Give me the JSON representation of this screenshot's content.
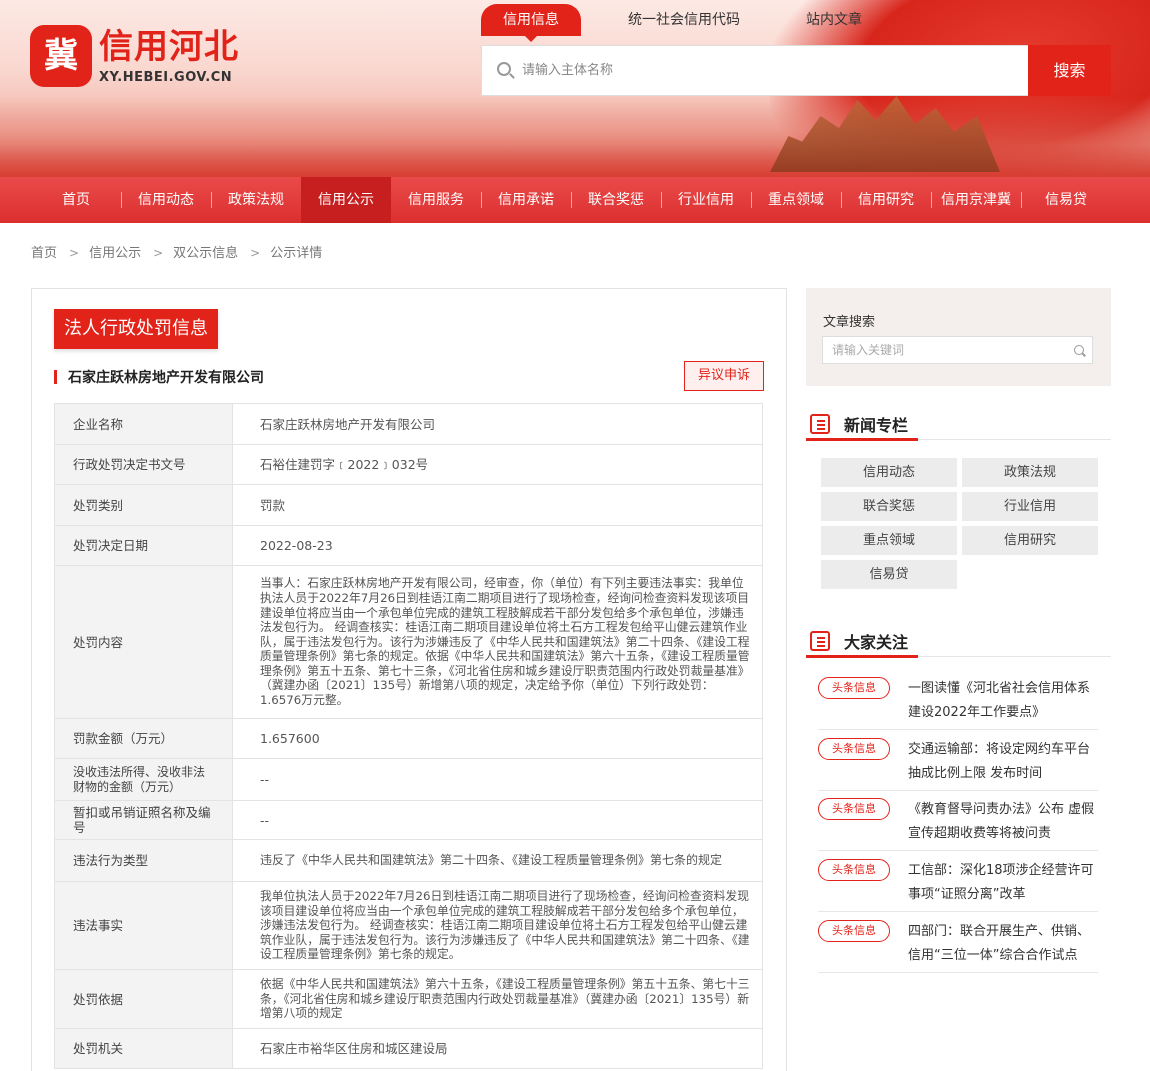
{
  "header": {
    "brand_name": "信用河北",
    "brand_url": "XY.HEBEI.GOV.CN",
    "search_tabs": [
      "信用信息",
      "统一社会信用代码",
      "站内文章"
    ],
    "search_placeholder": "请输入主体名称",
    "search_button": "搜索"
  },
  "nav": {
    "items": [
      "首页",
      "信用动态",
      "政策法规",
      "信用公示",
      "信用服务",
      "信用承诺",
      "联合奖惩",
      "行业信用",
      "重点领域",
      "信用研究",
      "信用京津冀",
      "信易贷"
    ],
    "active": "信用公示"
  },
  "breadcrumb": [
    "首页",
    "信用公示",
    "双公示信息",
    "公示详情"
  ],
  "main": {
    "title": "法人行政处罚信息",
    "company": "石家庄跃林房地产开发有限公司",
    "objection_button": "异议申诉",
    "rows": [
      {
        "label": "企业名称",
        "value": "石家庄跃林房地产开发有限公司"
      },
      {
        "label": "行政处罚决定书文号",
        "value": "石裕住建罚字﹝2022﹞032号"
      },
      {
        "label": "处罚类别",
        "value": "罚款"
      },
      {
        "label": "处罚决定日期",
        "value": "2022-08-23"
      },
      {
        "label": "处罚内容",
        "value": "当事人：石家庄跃林房地产开发有限公司，经审查，你（单位）有下列主要违法事实：我单位执法人员于2022年7月26日到桂语江南二期项目进行了现场检查，经询问检查资料发现该项目建设单位将应当由一个承包单位完成的建筑工程肢解成若干部分发包给多个承包单位，涉嫌违法发包行为。 经调查核实：桂语江南二期项目建设单位将土石方工程发包给平山健云建筑作业队，属于违法发包行为。该行为涉嫌违反了《中华人民共和国建筑法》第二十四条、《建设工程质量管理条例》第七条的规定。依据《中华人民共和国建筑法》第六十五条，《建设工程质量管理条例》第五十五条、第七十三条，《河北省住房和城乡建设厅职责范围内行政处罚裁量基准》（冀建办函〔2021〕135号）新增第八项的规定，决定给予你（单位）下列行政处罚：1.6576万元整。"
      },
      {
        "label": "罚款金额（万元）",
        "value": "1.657600"
      },
      {
        "label": "没收违法所得、没收非法财物的金额（万元）",
        "value": "--"
      },
      {
        "label": "暂扣或吊销证照名称及编号",
        "value": "--"
      },
      {
        "label": "违法行为类型",
        "value": "违反了《中华人民共和国建筑法》第二十四条、《建设工程质量管理条例》第七条的规定"
      },
      {
        "label": "违法事实",
        "value": "我单位执法人员于2022年7月26日到桂语江南二期项目进行了现场检查，经询问检查资料发现该项目建设单位将应当由一个承包单位完成的建筑工程肢解成若干部分发包给多个承包单位，涉嫌违法发包行为。 经调查核实：桂语江南二期项目建设单位将土石方工程发包给平山健云建筑作业队，属于违法发包行为。该行为涉嫌违反了《中华人民共和国建筑法》第二十四条、《建设工程质量管理条例》第七条的规定。"
      },
      {
        "label": "处罚依据",
        "value": "依据《中华人民共和国建筑法》第六十五条，《建设工程质量管理条例》第五十五条、第七十三条，《河北省住房和城乡建设厅职责范围内行政处罚裁量基准》（冀建办函〔2021〕135号）新增第八项的规定"
      },
      {
        "label": "处罚机关",
        "value": "石家庄市裕华区住房和城区建设局"
      }
    ]
  },
  "sidebar": {
    "search_label": "文章搜索",
    "search_placeholder": "请输入关键词",
    "news_title": "新闻专栏",
    "news_tags": [
      "信用动态",
      "政策法规",
      "联合奖惩",
      "行业信用",
      "重点领域",
      "信用研究",
      "信易贷"
    ],
    "hot_title": "大家关注",
    "hot_badge": "头条信息",
    "hot_items": [
      "一图读懂《河北省社会信用体系建设2022年工作要点》",
      "交通运输部：将设定网约车平台抽成比例上限 发布时间",
      "《教育督导问责办法》公布 虚假宣传超期收费等将被问责",
      "工信部：深化18项涉企经营许可事项“证照分离”改革",
      "四部门：联合开展生产、供销、信用“三位一体”综合合作试点"
    ]
  },
  "colors": {
    "brand_red": "#e2231a",
    "nav_red": "#dc2f2f",
    "nav_active": "#c71f1f"
  }
}
